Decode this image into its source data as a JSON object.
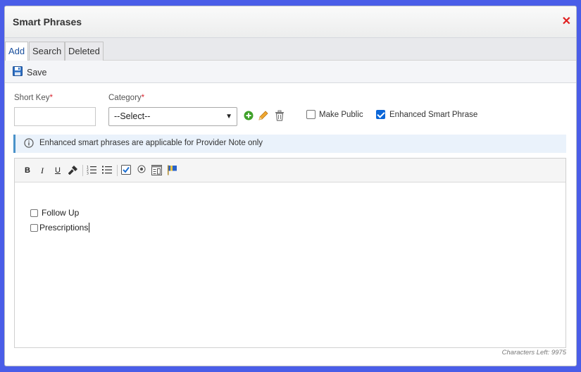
{
  "dialog": {
    "title": "Smart Phrases"
  },
  "tabs": [
    {
      "label": "Add",
      "active": true
    },
    {
      "label": "Search",
      "active": false
    },
    {
      "label": "Deleted",
      "active": false
    }
  ],
  "toolbar": {
    "save_label": "Save"
  },
  "form": {
    "short_key_label": "Short Key",
    "short_key_value": "",
    "category_label": "Category",
    "required_mark": "*",
    "category_selected": "--Select--",
    "make_public_label": "Make Public",
    "make_public_checked": false,
    "enhanced_label": "Enhanced Smart Phrase",
    "enhanced_checked": true
  },
  "info": {
    "message": "Enhanced smart phrases are applicable for Provider Note only"
  },
  "editor": {
    "toolbar": {
      "bold": "B",
      "italic": "I",
      "underline": "U"
    },
    "lines": [
      {
        "text": "Follow Up",
        "checked": false
      },
      {
        "text": "Prescriptions",
        "checked": false
      }
    ]
  },
  "status": {
    "chars_left": "Characters Left: 9975"
  },
  "colors": {
    "accent": "#1a4f9c",
    "close": "#e02020",
    "info_border": "#4a92c9",
    "frame": "#4a5de8"
  }
}
